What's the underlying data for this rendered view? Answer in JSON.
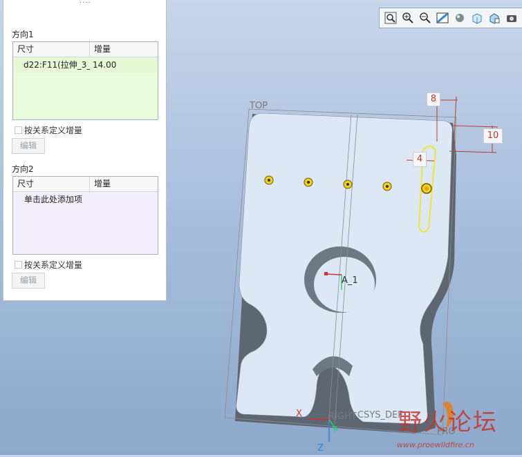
{
  "panel": {
    "grip": "····",
    "direction1": {
      "title": "方向1",
      "col_dimension": "尺寸",
      "col_increment": "增量",
      "rows": [
        {
          "dimension": "d22:F11(拉伸_3_",
          "increment": "14.00"
        }
      ],
      "relation_checkbox": "按关系定义增量",
      "edit_button": "编辑"
    },
    "direction2": {
      "title": "方向2",
      "col_dimension": "尺寸",
      "col_increment": "增量",
      "add_hint": "单击此处添加项",
      "relation_checkbox": "按关系定义增量",
      "edit_button": "编辑"
    }
  },
  "toolbar": {
    "icons": [
      "zoom-fit-icon",
      "zoom-in-icon",
      "zoom-out-icon",
      "repaint-icon",
      "display-style-icon",
      "saved-views-icon",
      "view-manager-icon",
      "appearance-icon"
    ]
  },
  "model": {
    "top_label": "TOP",
    "axis_label": "A_1",
    "csys_label": "CSYS_DEF",
    "right_label": "RIGHT",
    "front_label": "FRO",
    "axis_x": "X",
    "axis_y": "Y",
    "axis_z": "Z",
    "dimensions": {
      "d8": "8",
      "d10": "10",
      "d4": "4"
    }
  },
  "watermark": {
    "text": "野火论坛",
    "url": "www.proewildfire.cn"
  },
  "colors": {
    "dimension": "#c0392b",
    "part_face": "#dce7f5",
    "part_side": "#6d7581",
    "sketch_highlight": "#f0e442",
    "axis_green": "#2ecc71",
    "axis_blue": "#2e86de",
    "csys_red": "#d63031"
  }
}
